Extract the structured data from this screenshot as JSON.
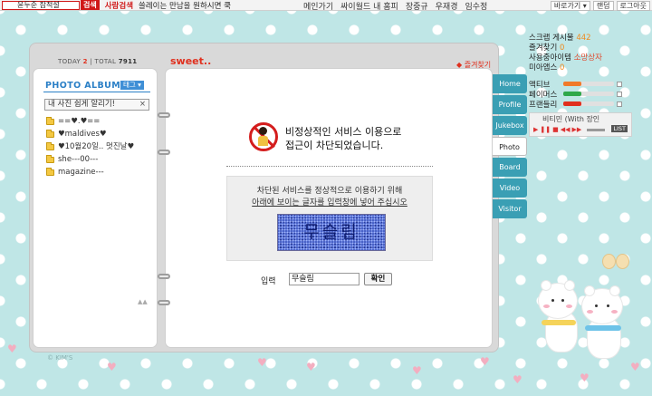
{
  "topbar": {
    "search_value": "윤두준 잠적설",
    "search_btn": "검색",
    "person_search": "사람검색",
    "marquee": "쓸레이는 만남을 원하시면 쿡",
    "nav": [
      "메인가기",
      "싸이월드 내 홈피",
      "장중규",
      "우재경",
      "임수정"
    ],
    "right": [
      "바로가기 ▾",
      "랜덤",
      "로그아웃"
    ]
  },
  "counter": {
    "today_label": "TODAY",
    "today": "2",
    "total_label": "TOTAL",
    "total": "7911"
  },
  "title": "sweet..",
  "favorite": "즐겨찾기",
  "album": {
    "title": "PHOTO ALBUM",
    "tag_btn": "태그 ▾",
    "selected_folder": "내 사진 쉽게 알리기!",
    "folders": [
      "==♥.♥==",
      "♥maldives♥",
      "♥10월20일.. 멋진날♥",
      "she---00---",
      "magazine---"
    ]
  },
  "block": {
    "line1": "비정상적인 서비스 이용으로",
    "line2": "접근이 차단되었습니다.",
    "instr1": "차단된 서비스를 정상적으로 이용하기 위해",
    "instr2": "아래에 보이는 글자를 입력창에 넣어 주십시오",
    "captcha": "무슬림",
    "input_label": "입력",
    "input_value": "무슬림",
    "confirm": "확인"
  },
  "tabs": [
    {
      "label": "Home",
      "active": false
    },
    {
      "label": "Profile",
      "active": false
    },
    {
      "label": "Jukebox",
      "active": false
    },
    {
      "label": "Photo",
      "active": true
    },
    {
      "label": "Board",
      "active": false
    },
    {
      "label": "Video",
      "active": false
    },
    {
      "label": "Visitor",
      "active": false
    }
  ],
  "sidebar": {
    "scrap": "스크랩 게시물",
    "scrap_count": "442",
    "favs": "즐겨찾기",
    "favs_count": "0",
    "items": "사용중아이템",
    "gift": "소망상자",
    "miapps": "미아앱스",
    "miapps_count": "0",
    "stats": [
      {
        "label": "액티브",
        "value": 0.35,
        "color": "#f07a2a"
      },
      {
        "label": "페이머스",
        "value": 0.35,
        "color": "#2ea84a"
      },
      {
        "label": "프랜들리",
        "value": 0.35,
        "color": "#e0301e"
      }
    ],
    "player_track": "비티민 (With 장인"
  },
  "copyright": "© KIM'S"
}
